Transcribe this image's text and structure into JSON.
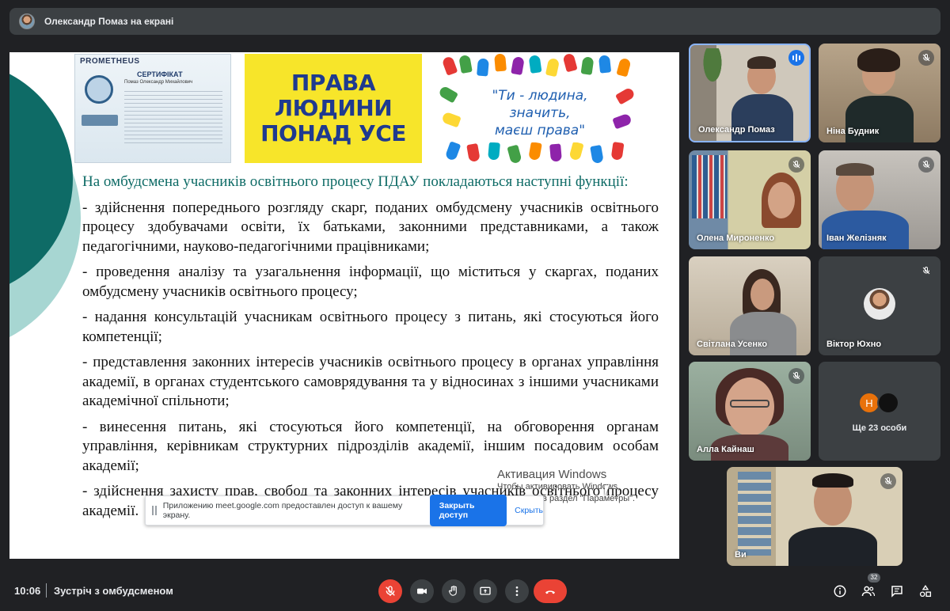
{
  "topbar": {
    "presenter_label": "Олександр Помаз на екрані"
  },
  "slide": {
    "cert_brand": "PROMETHEUS",
    "cert_title": "СЕРТИФІКАТ",
    "cert_name": "Помаз Олександр Михайлович",
    "poster_lines": [
      "ПРАВА",
      "ЛЮДИНИ",
      "ПОНАД УСЕ"
    ],
    "quote_lines": [
      "\"Ти - людина,",
      "значить,",
      "маєш права\""
    ],
    "intro": "На омбудсмена учасників освітнього процесу ПДАУ покладаються наступні функції:",
    "items": [
      "- здійснення попереднього розгляду скарг, поданих омбудсмену учасників освітнього процесу здобувачами освіти, їх батьками, законними представниками, а також педагогічними, науково-педагогічними працівниками;",
      "- проведення аналізу та узагальнення інформації, що міститься у скаргах, поданих омбудсмену учасників освітнього процесу;",
      " - надання консультацій учасникам освітнього процесу з питань, які стосуються його компетенції;",
      "- представлення законних інтересів учасників освітнього процесу в органах управління академії, в органах студентського самоврядування та у відносинах з іншими учасниками академічної спільноти;",
      "- винесення питань, які стосуються його компетенції, на обговорення органам управління, керівникам структурних підрозділів академії, іншим посадовим особам академії;",
      "- здійснення захисту прав, свобод та законних інтересів учасників освітнього процесу академії."
    ]
  },
  "share_notice": {
    "text": "Приложению meet.google.com предоставлен доступ к вашему экрану.",
    "stop_button": "Закрыть доступ",
    "hide_link": "Скрыть"
  },
  "watermark": {
    "title": "Активация Windows",
    "line1": "Чтобы активировать Windows,",
    "line2": "перейдите в раздел \"Параметры\"."
  },
  "participants": [
    {
      "name": "Олександр Помаз",
      "speaking": true
    },
    {
      "name": "Ніна Будник",
      "muted": true
    },
    {
      "name": "Олена Мироненко",
      "muted": true
    },
    {
      "name": "Іван Желізняк",
      "muted": true
    },
    {
      "name": "Світлана Усенко",
      "muted": true
    },
    {
      "name": "Віктор Юхно",
      "muted": true
    },
    {
      "name": "Алла Кайнаш",
      "muted": true
    },
    {
      "initial": "Н",
      "more_label": "Ще 23 особи"
    },
    {
      "name": "Ви",
      "muted": true
    }
  ],
  "bottombar": {
    "time": "10:06",
    "meeting_name": "Зустріч з омбудсменом",
    "people_count": "32"
  },
  "colors": {
    "accent_teal": "#0e6b66",
    "end_call_red": "#ea4335",
    "active_border": "#8ab4f8"
  }
}
